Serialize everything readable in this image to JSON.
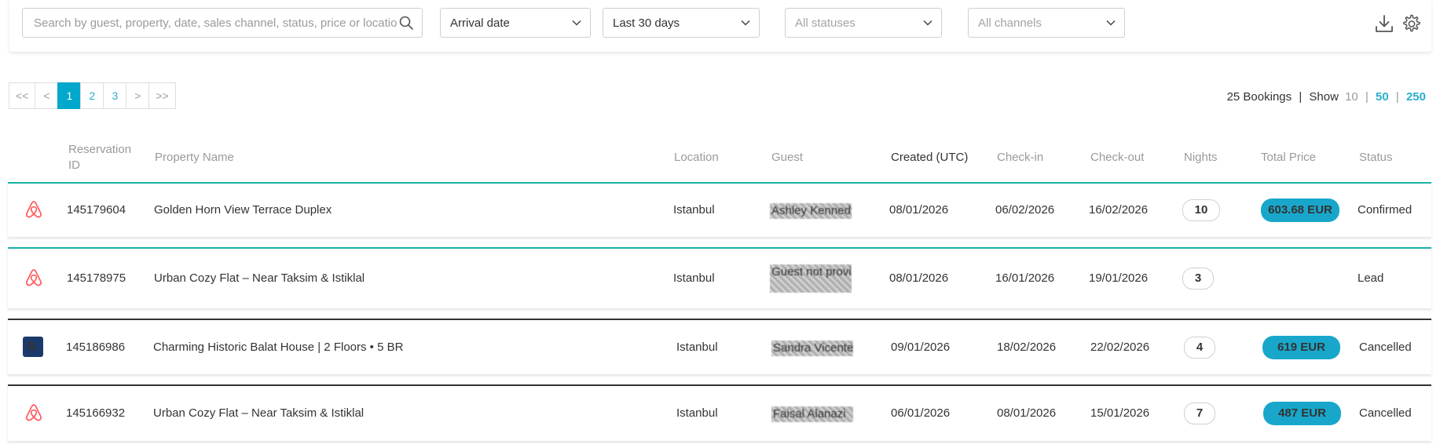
{
  "filters": {
    "search_placeholder": "Search by guest, property, date, sales channel, status, price or location",
    "date_type": "Arrival date",
    "date_range": "Last 30 days",
    "status": "All statuses",
    "channel": "All channels"
  },
  "pagination": {
    "first": "<<",
    "prev": "<",
    "pages": [
      "1",
      "2",
      "3"
    ],
    "active_page": "1",
    "next": ">",
    "last": ">>"
  },
  "summary": {
    "count": "25 Bookings",
    "sep": "|",
    "show_label": "Show",
    "options": [
      "10",
      "50",
      "250"
    ]
  },
  "columns": {
    "reservation_id": "Reservation ID",
    "property": "Property Name",
    "location": "Location",
    "guest": "Guest",
    "created": "Created (UTC)",
    "checkin": "Check-in",
    "checkout": "Check-out",
    "nights": "Nights",
    "total": "Total Price",
    "status": "Status"
  },
  "rows": [
    {
      "channel_icon": "airbnb-icon",
      "id": "145179604",
      "property": "Golden Horn View Terrace Duplex",
      "location": "Istanbul",
      "guest": "Ashley Kennedy",
      "created": "08/01/2026",
      "checkin": "06/02/2026",
      "checkout": "16/02/2026",
      "nights": "10",
      "total": "603.68 EUR",
      "status": "Confirmed"
    },
    {
      "channel_icon": "airbnb-icon",
      "id": "145178975",
      "property": "Urban Cozy Flat – Near Taksim & Istiklal",
      "location": "Istanbul",
      "guest": "Guest not provided",
      "created": "08/01/2026",
      "checkin": "16/01/2026",
      "checkout": "19/01/2026",
      "nights": "3",
      "total": "",
      "status": "Lead"
    },
    {
      "channel_icon": "booking-icon",
      "id": "145186986",
      "property": "Charming Historic Balat House | 2 Floors • 5 BR",
      "location": "Istanbul",
      "guest": "Sandra Vicente",
      "created": "09/01/2026",
      "checkin": "18/02/2026",
      "checkout": "22/02/2026",
      "nights": "4",
      "total": "619 EUR",
      "status": "Cancelled"
    },
    {
      "channel_icon": "airbnb-icon",
      "id": "145166932",
      "property": "Urban Cozy Flat – Near Taksim & Istiklal",
      "location": "Istanbul",
      "guest": "Faisal Alanazi",
      "created": "06/01/2026",
      "checkin": "08/01/2026",
      "checkout": "15/01/2026",
      "nights": "7",
      "total": "487 EUR",
      "status": "Cancelled"
    }
  ],
  "colors": {
    "accent": "#00a8cc",
    "airbnb": "#ff5a5f",
    "booking": "#1b3a6b",
    "confirmed_border": "#18b3a6",
    "cancelled_border": "#333333"
  }
}
